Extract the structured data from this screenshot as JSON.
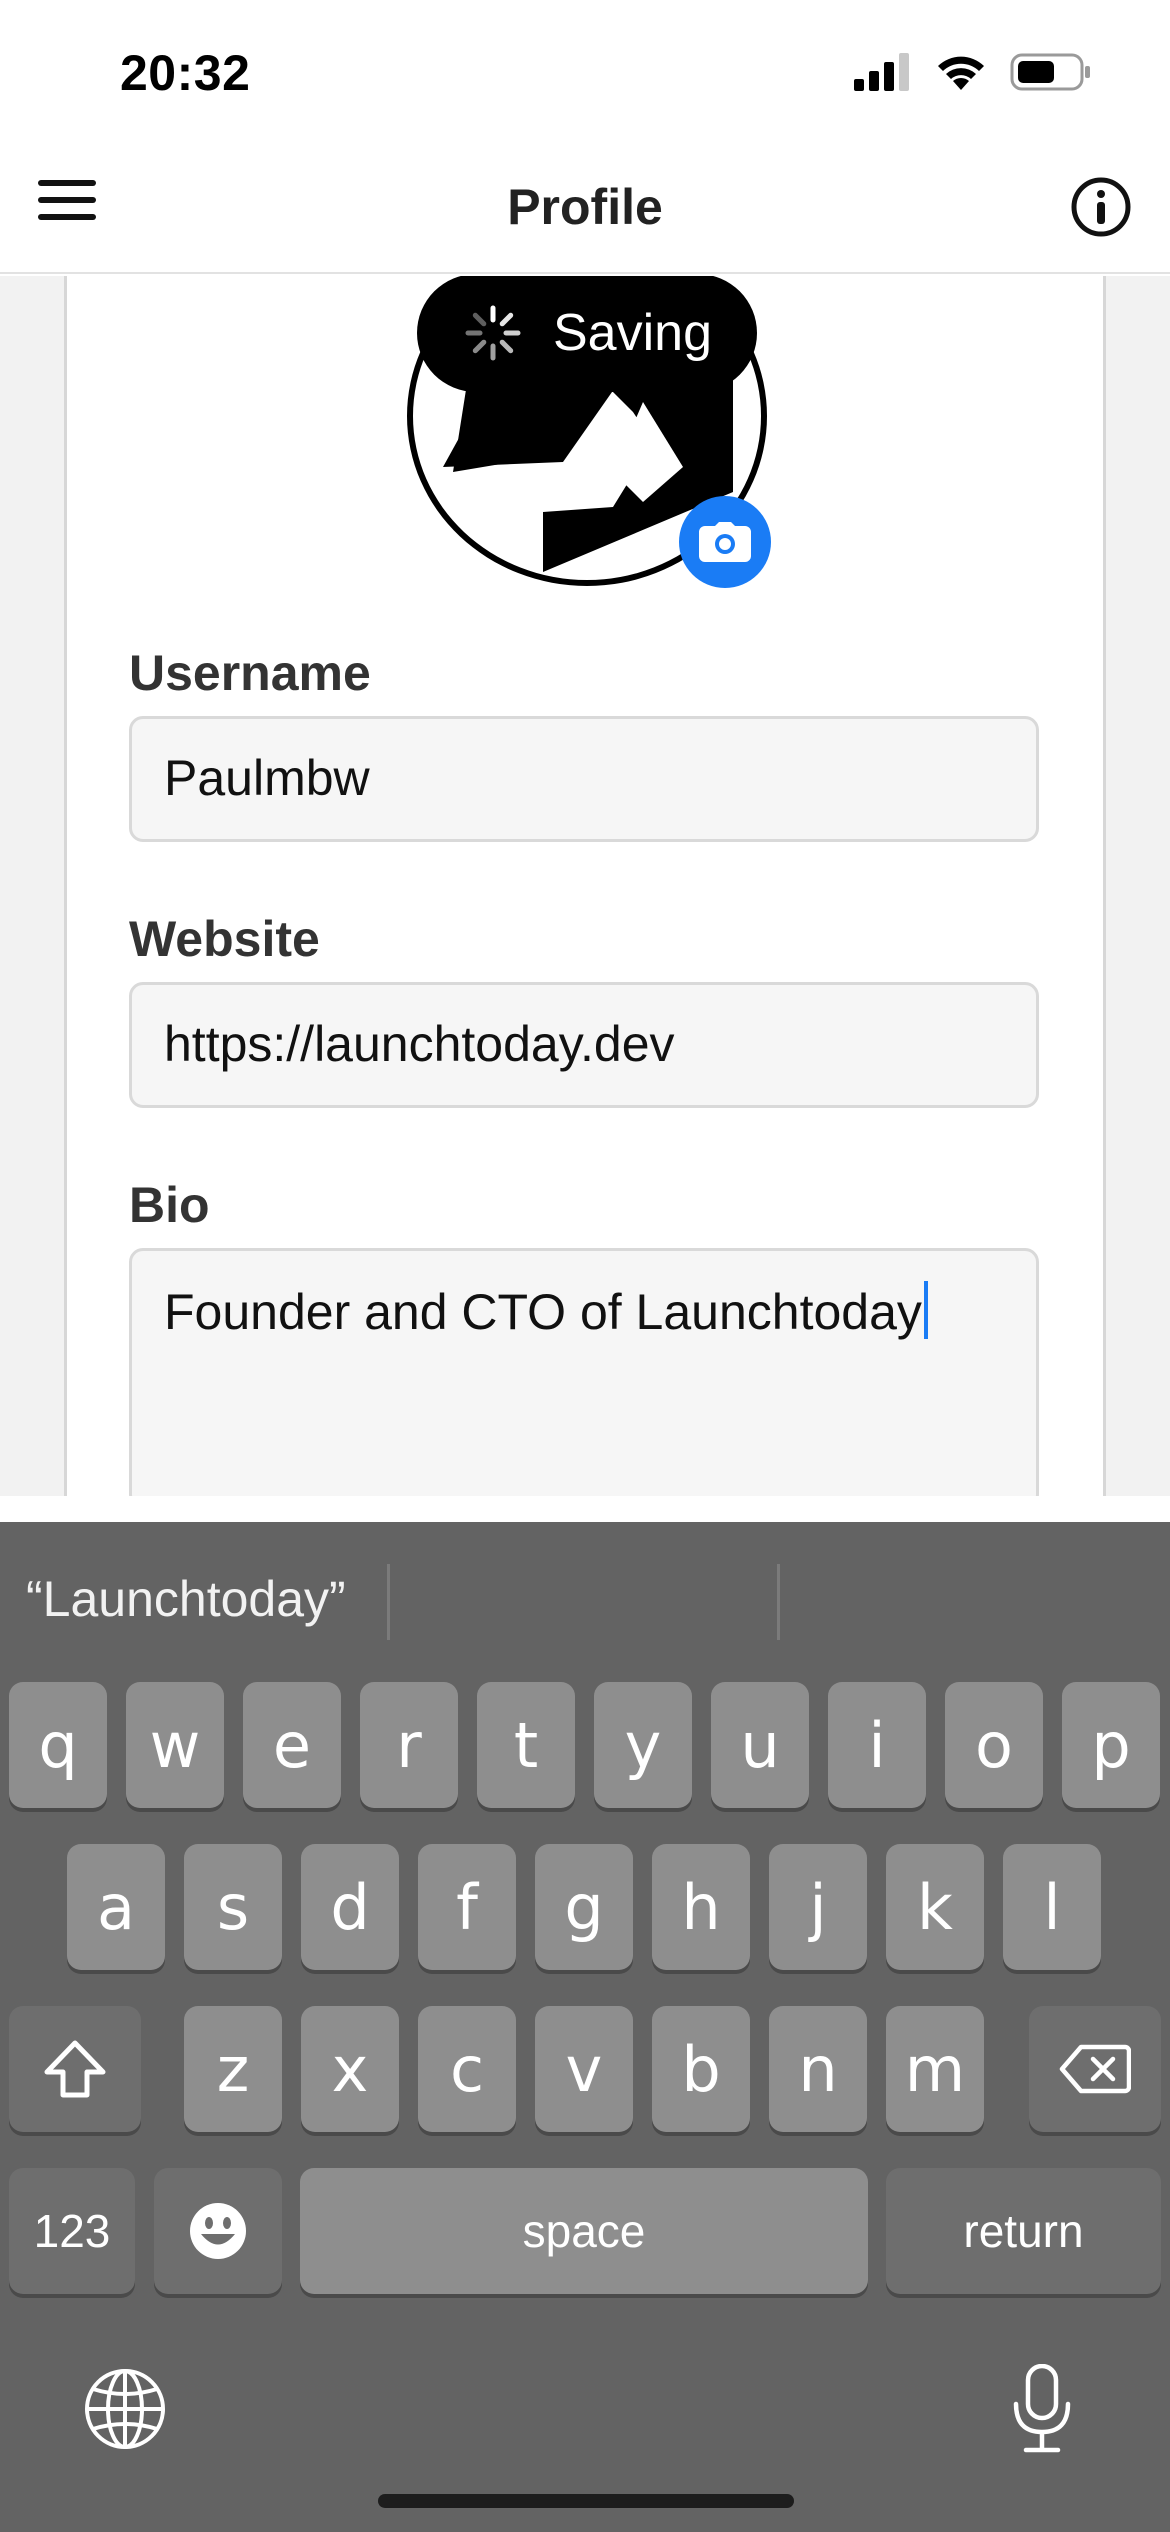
{
  "status_bar": {
    "time": "20:32"
  },
  "nav": {
    "title": "Profile"
  },
  "avatar": {
    "saving_label": "Saving"
  },
  "form": {
    "username_label": "Username",
    "username_value": "Paulmbw",
    "website_label": "Website",
    "website_value": "https://launchtoday.dev",
    "bio_label": "Bio",
    "bio_value": "Founder and CTO of Launchtoday"
  },
  "keyboard": {
    "suggestion_1": "“Launchtoday”",
    "row1": [
      "q",
      "w",
      "e",
      "r",
      "t",
      "y",
      "u",
      "i",
      "o",
      "p"
    ],
    "row2": [
      "a",
      "s",
      "d",
      "f",
      "g",
      "h",
      "j",
      "k",
      "l"
    ],
    "row3": [
      "z",
      "x",
      "c",
      "v",
      "b",
      "n",
      "m"
    ],
    "numbers_label": "123",
    "space_label": "space",
    "return_label": "return"
  },
  "colors": {
    "accent": "#1a7cf5",
    "keyboard_bg": "#636363",
    "key_bg": "#8e8e8e"
  }
}
